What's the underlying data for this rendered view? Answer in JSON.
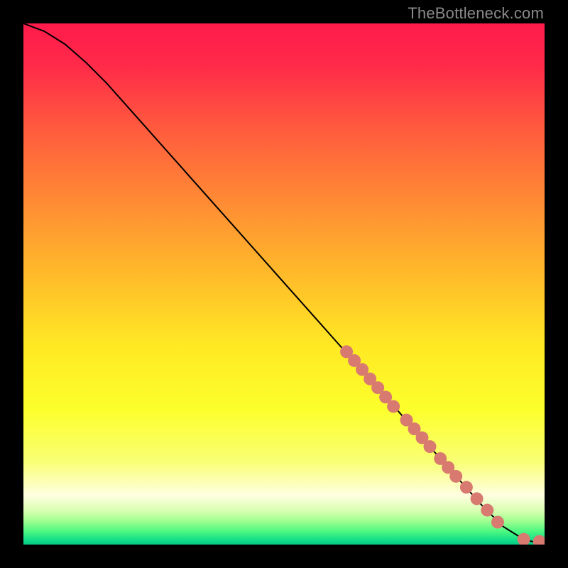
{
  "watermark": "TheBottleneck.com",
  "chart_data": {
    "type": "line",
    "title": "",
    "xlabel": "",
    "ylabel": "",
    "xlim": [
      0,
      100
    ],
    "ylim": [
      0,
      100
    ],
    "grid": false,
    "axes_visible": false,
    "curve": {
      "x": [
        0,
        4,
        8,
        12,
        16,
        20,
        24,
        28,
        32,
        36,
        40,
        44,
        48,
        52,
        56,
        60,
        64,
        68,
        72,
        76,
        80,
        84,
        88,
        92,
        96,
        98,
        100
      ],
      "y": [
        100,
        98.5,
        96,
        92.5,
        88.5,
        84,
        79.5,
        75,
        70.5,
        66,
        61.5,
        57,
        52.5,
        48,
        43.5,
        39,
        34.5,
        30,
        25.5,
        21,
        16.5,
        12,
        7.5,
        3.5,
        1,
        0.5,
        0.5
      ]
    },
    "markers": {
      "x": [
        62,
        63.5,
        65,
        66.5,
        68,
        69.5,
        71,
        73.5,
        75,
        76.5,
        78,
        80,
        81.5,
        83,
        85,
        87,
        89,
        91,
        96,
        99
      ],
      "y": [
        37,
        35.3,
        33.6,
        31.8,
        30.1,
        28.3,
        26.5,
        23.9,
        22.2,
        20.5,
        18.8,
        16.5,
        14.8,
        13.1,
        11.0,
        8.8,
        6.6,
        4.3,
        1.0,
        0.6
      ]
    },
    "gradient_stops": [
      {
        "pos": 0.0,
        "color": "#ff1b4b"
      },
      {
        "pos": 0.08,
        "color": "#ff2a49"
      },
      {
        "pos": 0.2,
        "color": "#ff5a3e"
      },
      {
        "pos": 0.34,
        "color": "#ff8a34"
      },
      {
        "pos": 0.48,
        "color": "#ffba2a"
      },
      {
        "pos": 0.62,
        "color": "#ffe924"
      },
      {
        "pos": 0.74,
        "color": "#fcff2b"
      },
      {
        "pos": 0.84,
        "color": "#f9ff74"
      },
      {
        "pos": 0.905,
        "color": "#ffffe0"
      },
      {
        "pos": 0.935,
        "color": "#d8ffb2"
      },
      {
        "pos": 0.955,
        "color": "#9fff90"
      },
      {
        "pos": 0.975,
        "color": "#4cf781"
      },
      {
        "pos": 0.992,
        "color": "#11dd88"
      },
      {
        "pos": 1.0,
        "color": "#06c985"
      }
    ]
  }
}
